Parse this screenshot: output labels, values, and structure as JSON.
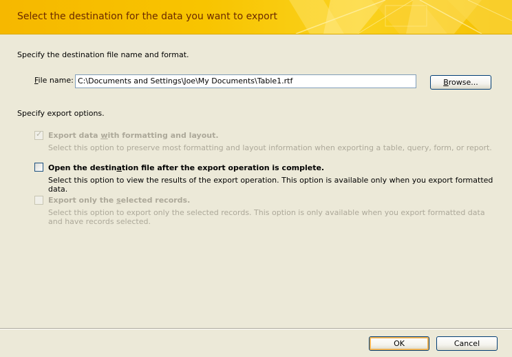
{
  "header": {
    "title": "Select the destination for the data you want to export"
  },
  "destination": {
    "section_label": "Specify the destination file name and format.",
    "file_label": "File name:",
    "file_value": "C:\\Documents and Settings\\Joe\\My Documents\\Table1.rtf",
    "browse_label": "Browse..."
  },
  "options": {
    "section_label": "Specify export options.",
    "items": [
      {
        "title": "Export data with formatting and layout.",
        "description": "Select this option to preserve most formatting and layout information when exporting a table, query, form, or report.",
        "checked": true,
        "enabled": false
      },
      {
        "title": "Open the destination file after the export operation is complete.",
        "description": "Select this option to view the results of the export operation. This option is available only when you export formatted data.",
        "checked": false,
        "enabled": true
      },
      {
        "title": "Export only the selected records.",
        "description": "Select this option to export only the selected records. This option is only available when you export formatted data and have records selected.",
        "checked": false,
        "enabled": false
      }
    ]
  },
  "footer": {
    "ok_label": "OK",
    "cancel_label": "Cancel"
  }
}
